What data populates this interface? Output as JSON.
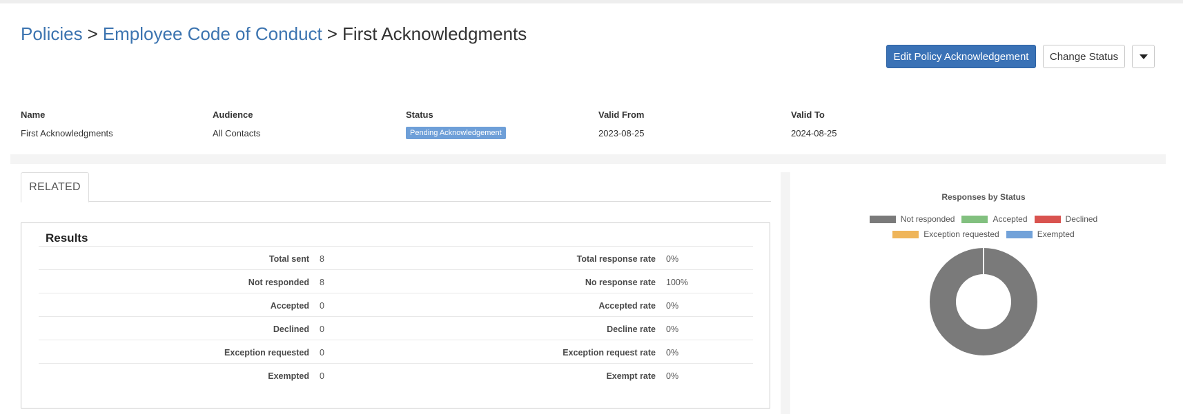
{
  "breadcrumb": {
    "items": [
      "Policies",
      "Employee Code of Conduct"
    ],
    "separator": ">",
    "current": "First Acknowledgments"
  },
  "actions": {
    "edit_label": "Edit Policy Acknowledgement",
    "change_status_label": "Change Status"
  },
  "info": {
    "name_label": "Name",
    "name_value": "First Acknowledgments",
    "audience_label": "Audience",
    "audience_value": "All Contacts",
    "status_label": "Status",
    "status_value": "Pending Acknowledgement",
    "valid_from_label": "Valid From",
    "valid_from_value": "2023-08-25",
    "valid_to_label": "Valid To",
    "valid_to_value": "2024-08-25"
  },
  "tabs": {
    "related_label": "RELATED"
  },
  "results": {
    "title": "Results",
    "rows": [
      {
        "k1": "Total sent",
        "v1": "8",
        "k2": "Total response rate",
        "v2": "0%"
      },
      {
        "k1": "Not responded",
        "v1": "8",
        "k2": "No response rate",
        "v2": "100%"
      },
      {
        "k1": "Accepted",
        "v1": "0",
        "k2": "Accepted rate",
        "v2": "0%"
      },
      {
        "k1": "Declined",
        "v1": "0",
        "k2": "Decline rate",
        "v2": "0%"
      },
      {
        "k1": "Exception requested",
        "v1": "0",
        "k2": "Exception request rate",
        "v2": "0%"
      },
      {
        "k1": "Exempted",
        "v1": "0",
        "k2": "Exempt rate",
        "v2": "0%"
      }
    ]
  },
  "colors": {
    "primary": "#3a72b6",
    "link": "#3c74b0",
    "badge": "#6e9fd8"
  },
  "chart_data": {
    "type": "pie",
    "title": "Responses by Status",
    "categories": [
      "Not responded",
      "Accepted",
      "Declined",
      "Exception requested",
      "Exempted"
    ],
    "values": [
      8,
      0,
      0,
      0,
      0
    ],
    "colors": [
      "#7a7a7a",
      "#82c07f",
      "#d9534f",
      "#efb55a",
      "#72a2d9"
    ],
    "donut": true,
    "legend": "top"
  }
}
